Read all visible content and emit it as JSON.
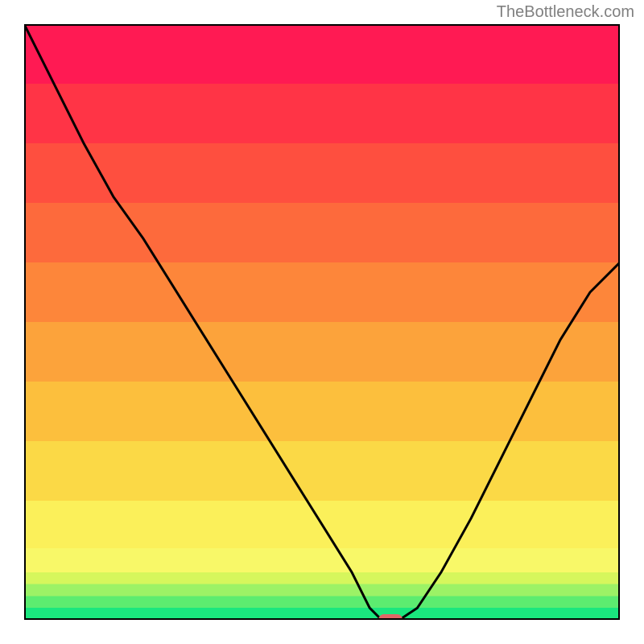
{
  "watermark": "TheBottleneck.com",
  "chart_data": {
    "type": "line",
    "title": "",
    "xlabel": "",
    "ylabel": "",
    "xlim": [
      0,
      100
    ],
    "ylim": [
      0,
      100
    ],
    "x": [
      0,
      5,
      10,
      15,
      20,
      25,
      30,
      35,
      40,
      45,
      50,
      55,
      58,
      60,
      63,
      66,
      70,
      75,
      80,
      85,
      90,
      95,
      100
    ],
    "values": [
      100,
      90,
      80,
      71,
      64,
      56,
      48,
      40,
      32,
      24,
      16,
      8,
      2,
      0,
      0,
      2,
      8,
      17,
      27,
      37,
      47,
      55,
      60
    ],
    "marker": {
      "x": 61.5,
      "y": 0
    },
    "gradient_bands": [
      {
        "y0": 0,
        "y1": 2,
        "color": "#1ae67e"
      },
      {
        "y0": 2,
        "y1": 4,
        "color": "#5cec70"
      },
      {
        "y0": 4,
        "y1": 6,
        "color": "#9cf266"
      },
      {
        "y0": 6,
        "y1": 8,
        "color": "#d6f65c"
      },
      {
        "y0": 8,
        "y1": 12,
        "color": "#f8f868"
      },
      {
        "y0": 12,
        "y1": 20,
        "color": "#fbf05a"
      },
      {
        "y0": 20,
        "y1": 30,
        "color": "#fbd946"
      },
      {
        "y0": 30,
        "y1": 40,
        "color": "#fcbf3d"
      },
      {
        "y0": 40,
        "y1": 50,
        "color": "#fca33b"
      },
      {
        "y0": 50,
        "y1": 60,
        "color": "#fd863a"
      },
      {
        "y0": 60,
        "y1": 70,
        "color": "#fd6a3c"
      },
      {
        "y0": 70,
        "y1": 80,
        "color": "#fe4f3f"
      },
      {
        "y0": 80,
        "y1": 90,
        "color": "#ff3446"
      },
      {
        "y0": 90,
        "y1": 100,
        "color": "#ff1a53"
      }
    ]
  }
}
